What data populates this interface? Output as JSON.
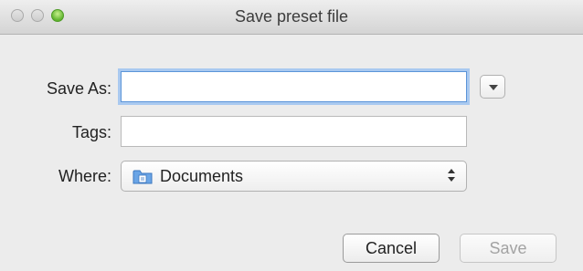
{
  "window": {
    "title": "Save preset file"
  },
  "form": {
    "save_as": {
      "label": "Save As:",
      "value": ""
    },
    "tags": {
      "label": "Tags:",
      "value": ""
    },
    "where": {
      "label": "Where:",
      "selected": "Documents",
      "icon": "documents-folder-icon"
    }
  },
  "buttons": {
    "cancel": "Cancel",
    "save": "Save"
  },
  "colors": {
    "focus_ring": "#a9c9f0",
    "zoom_light": "#5fb42e",
    "folder_blue": "#4f8fd6"
  }
}
